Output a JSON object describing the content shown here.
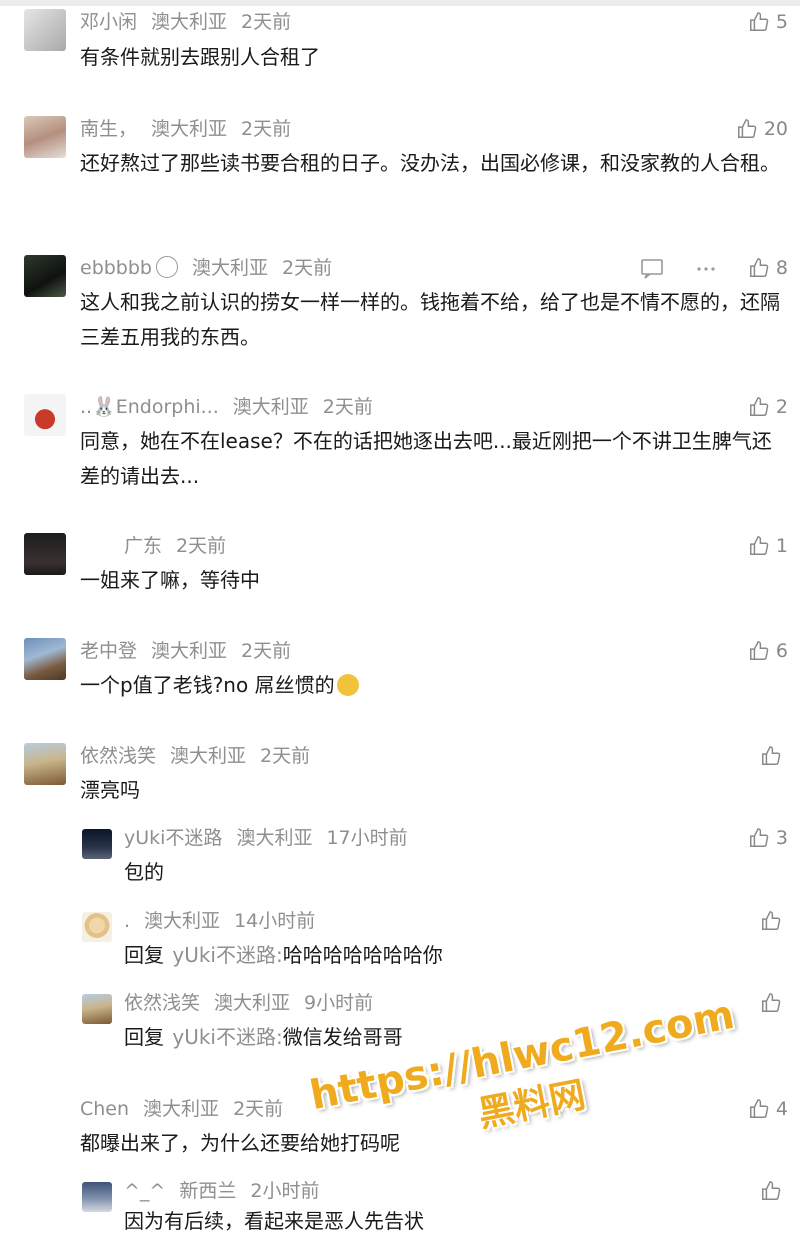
{
  "comments": [
    {
      "user": "邓小闲",
      "location": "澳大利亚",
      "time": "2天前",
      "text": "有条件就别去跟别人合租了",
      "likes": "5"
    },
    {
      "user": "南生，",
      "location": "澳大利亚",
      "time": "2天前",
      "text": "还好熬过了那些读书要合租的日子。没办法，出国必修课，和没家教的人合租。",
      "likes": "20"
    },
    {
      "user": "ebbbbb",
      "location": "澳大利亚",
      "time": "2天前",
      "text": "这人和我之前认识的捞女一样一样的。钱拖着不给，给了也是不情不愿的，还隔三差五用我的东西。",
      "likes": "8"
    },
    {
      "user": "..🐰Endorphi...",
      "location": "澳大利亚",
      "time": "2天前",
      "text": "同意，她在不在lease？不在的话把她逐出去吧...最近刚把一个不讲卫生脾气还差的请出去...",
      "likes": "2"
    },
    {
      "user": "",
      "location": "广东",
      "time": "2天前",
      "text": "一姐来了嘛，等待中",
      "likes": "1"
    },
    {
      "user": "老中登",
      "location": "澳大利亚",
      "time": "2天前",
      "text": "一个p值了老钱?no 屌丝惯的",
      "likes": "6"
    },
    {
      "user": "依然浅笑",
      "location": "澳大利亚",
      "time": "2天前",
      "text": "漂亮吗",
      "likes": ""
    },
    {
      "user": "yUki不迷路",
      "location": "澳大利亚",
      "time": "17小时前",
      "text": "包的",
      "likes": "3"
    },
    {
      "user": ".",
      "location": "澳大利亚",
      "time": "14小时前",
      "reply_prefix": "回复",
      "reply_to": "yUki不迷路:",
      "text": "哈哈哈哈哈哈哈你",
      "likes": ""
    },
    {
      "user": "依然浅笑",
      "location": "澳大利亚",
      "time": "9小时前",
      "reply_prefix": "回复",
      "reply_to": "yUki不迷路:",
      "text": "微信发给哥哥",
      "likes": ""
    },
    {
      "user": "Chen",
      "location": "澳大利亚",
      "time": "2天前",
      "text": "都曝出来了，为什么还要给她打码呢",
      "likes": "4"
    },
    {
      "user": "^_^",
      "location": "新西兰",
      "time": "2小时前",
      "text": "因为有后续，看起来是恶人先告状",
      "likes": ""
    }
  ],
  "watermark": {
    "url": "https://hlwc12.com",
    "text": "黑料网"
  },
  "icons": {
    "like": "thumbs-up-icon",
    "reply": "comment-icon",
    "more": "more-dots-icon"
  }
}
